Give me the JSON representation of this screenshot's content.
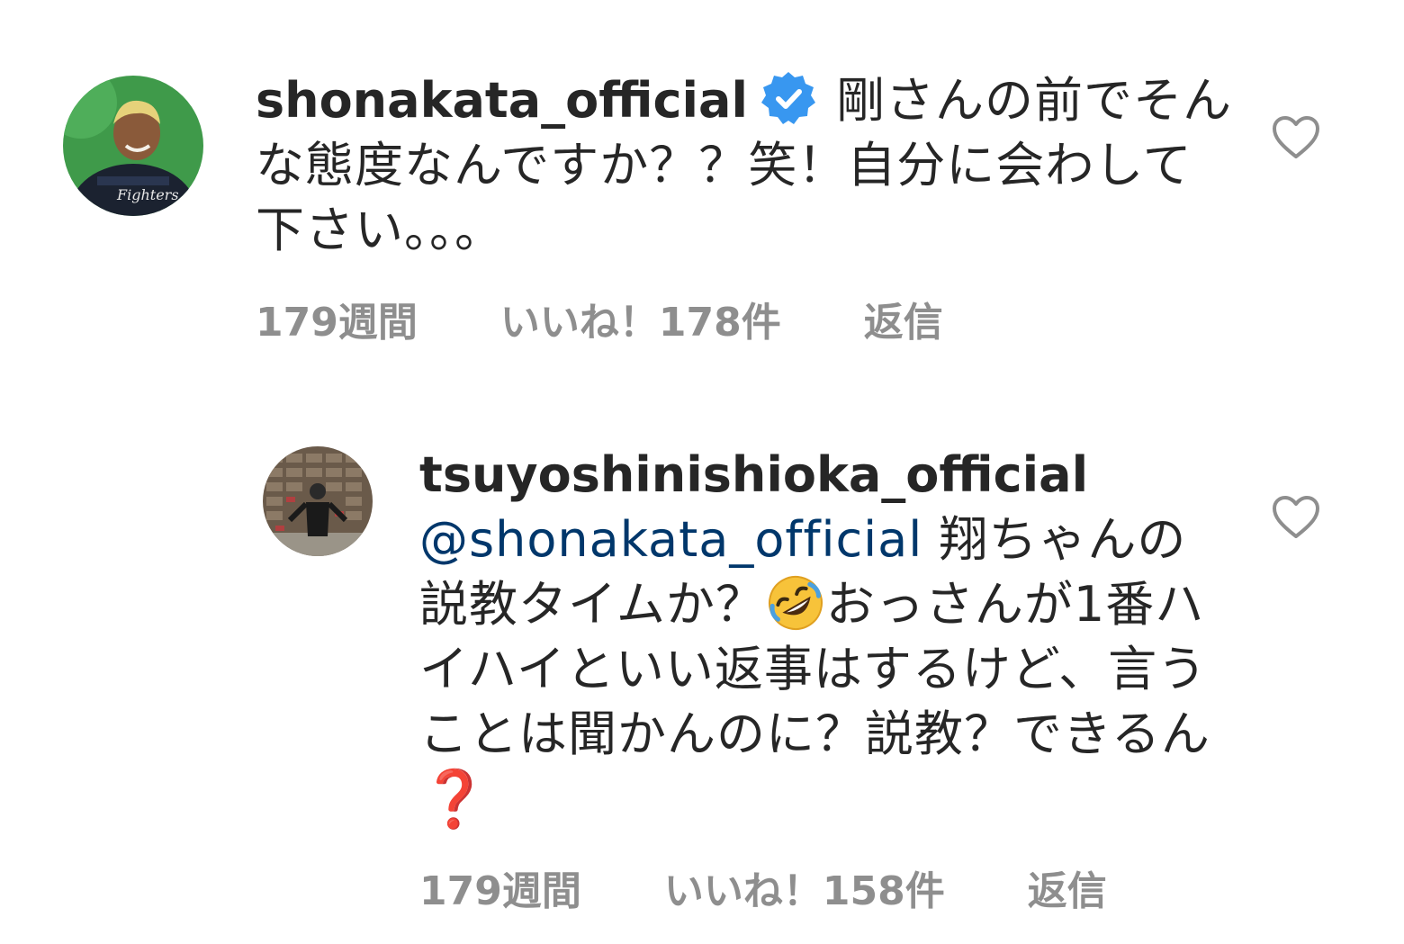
{
  "comments": [
    {
      "username": "shonakata_official",
      "verified": true,
      "text": "剛さんの前でそんな態度なんですか？？笑！自分に会わして下さい。。。",
      "time": "179週間",
      "likes": "いいね！178件",
      "reply": "返信",
      "avatar_icon": "profile-photo",
      "like_icon": "heart-outline-icon"
    },
    {
      "username": "tsuyoshinishioka_official",
      "verified": false,
      "mention": "@shonakata_official",
      "text_part1": "翔ちゃんの説教タイムか？",
      "emoji": "🤣",
      "text_part2": "おっさんが1番ハイハイといい返事はするけど、言うことは聞かんのに？説教？できるん",
      "trailing": "❓",
      "time": "179週間",
      "likes": "いいね！158件",
      "reply": "返信",
      "avatar_icon": "profile-photo",
      "like_icon": "heart-outline-icon"
    }
  ],
  "colors": {
    "text": "#262626",
    "meta": "#8e8e8e",
    "mention": "#00376b",
    "verified": "#3897f0"
  }
}
